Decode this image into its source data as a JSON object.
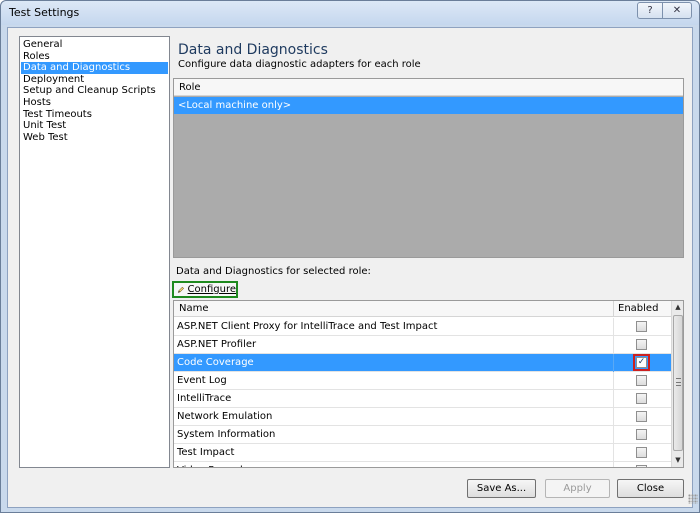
{
  "window": {
    "title": "Test Settings",
    "help_label": "?",
    "close_label": "✕"
  },
  "nav": {
    "items": [
      {
        "label": "General",
        "selected": false
      },
      {
        "label": "Roles",
        "selected": false
      },
      {
        "label": "Data and Diagnostics",
        "selected": true
      },
      {
        "label": "Deployment",
        "selected": false
      },
      {
        "label": "Setup and Cleanup Scripts",
        "selected": false
      },
      {
        "label": "Hosts",
        "selected": false
      },
      {
        "label": "Test Timeouts",
        "selected": false
      },
      {
        "label": "Unit Test",
        "selected": false
      },
      {
        "label": "Web Test",
        "selected": false
      }
    ]
  },
  "page": {
    "title": "Data and Diagnostics",
    "subtitle": "Configure data diagnostic adapters for each role"
  },
  "roles": {
    "header": "Role",
    "rows": [
      "<Local machine only>"
    ]
  },
  "adapters": {
    "section_label": "Data and Diagnostics for selected role:",
    "configure_label": "Configure",
    "columns": {
      "name": "Name",
      "enabled": "Enabled"
    },
    "rows": [
      {
        "name": "ASP.NET Client Proxy for IntelliTrace and Test Impact",
        "enabled": false,
        "selected": false
      },
      {
        "name": "ASP.NET Profiler",
        "enabled": false,
        "selected": false
      },
      {
        "name": "Code Coverage",
        "enabled": true,
        "selected": true
      },
      {
        "name": "Event Log",
        "enabled": false,
        "selected": false
      },
      {
        "name": "IntelliTrace",
        "enabled": false,
        "selected": false
      },
      {
        "name": "Network Emulation",
        "enabled": false,
        "selected": false
      },
      {
        "name": "System Information",
        "enabled": false,
        "selected": false
      },
      {
        "name": "Test Impact",
        "enabled": false,
        "selected": false
      },
      {
        "name": "Video Recorder",
        "enabled": false,
        "selected": false
      }
    ]
  },
  "footer": {
    "save_as_label": "Save As...",
    "apply_label": "Apply",
    "close_label": "Close"
  },
  "colors": {
    "selection": "#3399ff",
    "configure_highlight": "#1f8a1f",
    "checkbox_highlight": "#cc2020"
  }
}
